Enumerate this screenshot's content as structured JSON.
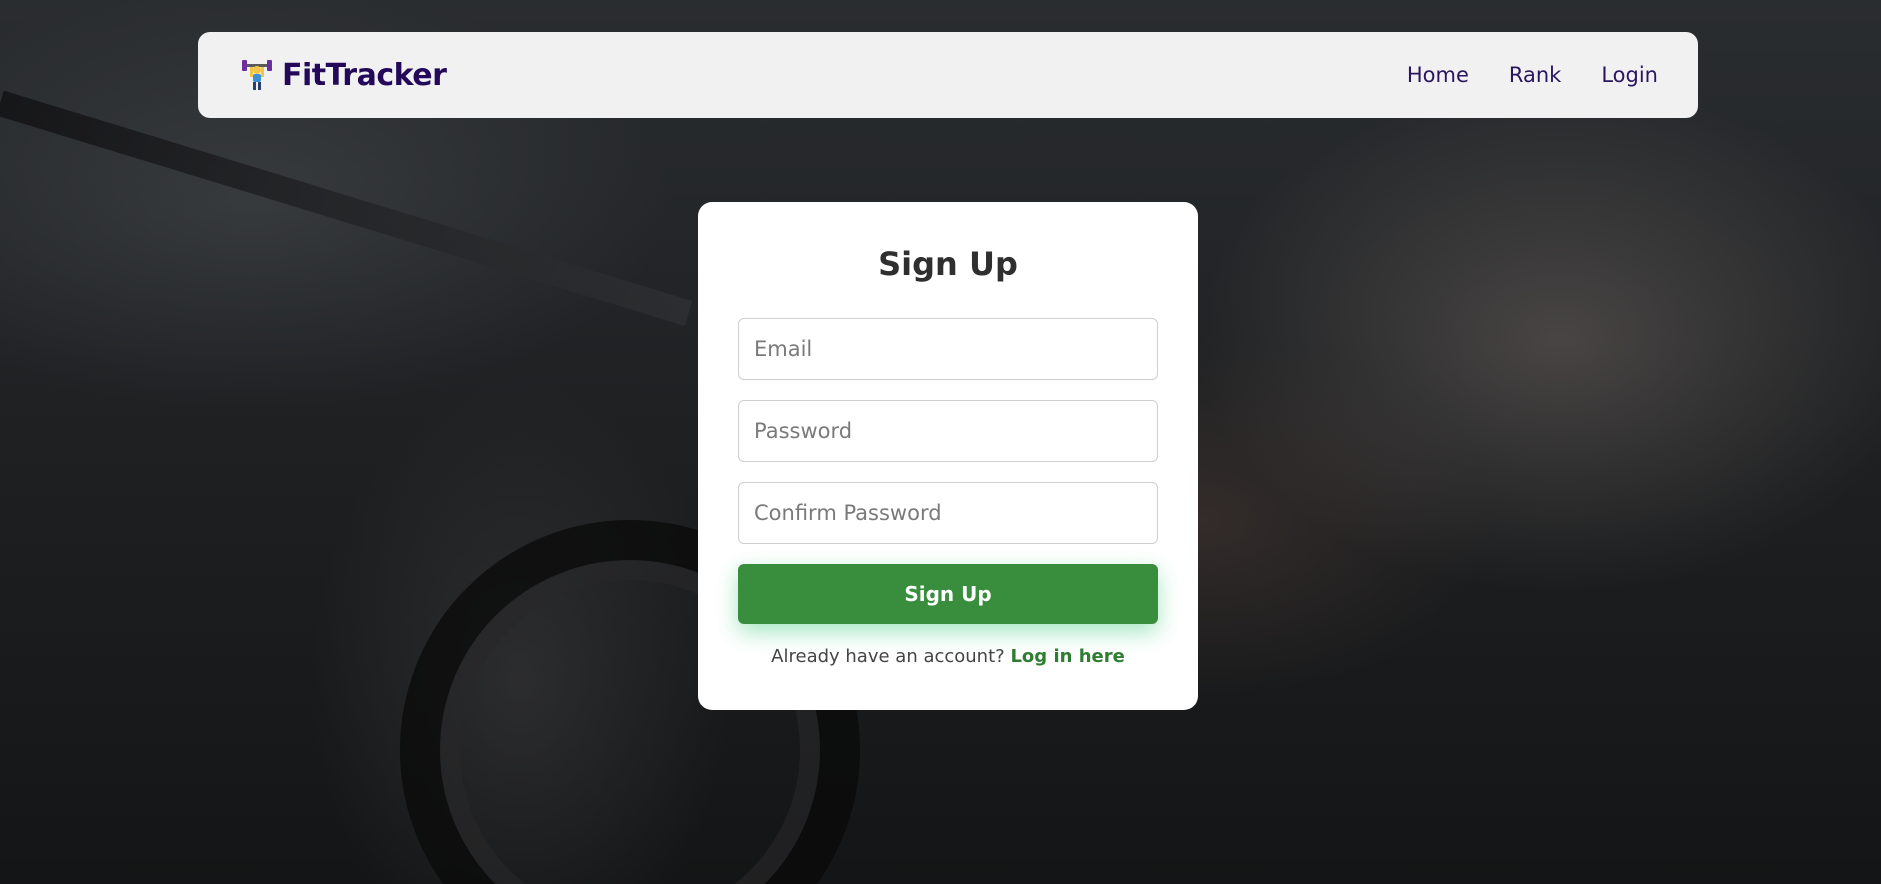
{
  "brand": {
    "name": "FitTracker",
    "icon": "weightlifter-icon"
  },
  "nav": {
    "items": [
      {
        "label": "Home"
      },
      {
        "label": "Rank"
      },
      {
        "label": "Login"
      }
    ]
  },
  "form": {
    "title": "Sign Up",
    "email_placeholder": "Email",
    "email_value": "",
    "password_placeholder": "Password",
    "password_value": "",
    "confirm_placeholder": "Confirm Password",
    "confirm_value": "",
    "submit_label": "Sign Up",
    "login_prompt": "Already have an account?",
    "login_link": "Log in here"
  },
  "colors": {
    "brand_text": "#24095a",
    "primary_button": "#388e3c",
    "link": "#2e7d32",
    "navbar_bg": "#f1f1f1"
  }
}
